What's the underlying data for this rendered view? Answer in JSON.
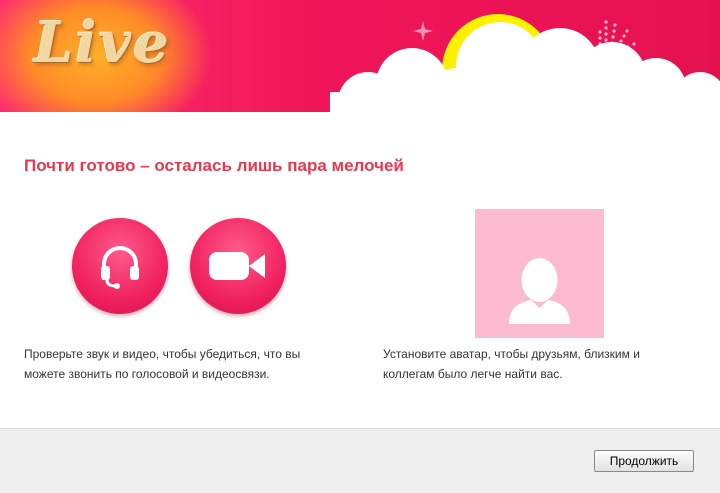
{
  "app": {
    "logo_text": "Live"
  },
  "main": {
    "heading": "Почти готово – осталась лишь пара мелочей",
    "check_devices": {
      "audio_icon": "headset-icon",
      "video_icon": "video-camera-icon",
      "description": "Проверьте звук и видео, чтобы убедиться, что вы можете звонить по голосовой и видеосвязи."
    },
    "avatar": {
      "icon": "user-silhouette-icon",
      "description": "Установите аватар, чтобы друзьям, близким и коллегам было легче найти вас."
    }
  },
  "footer": {
    "continue_label": "Продолжить"
  },
  "colors": {
    "accent": "#e8384f",
    "banner": "#f0155a",
    "sun": "#fff000",
    "avatar_bg": "#fcbbd1"
  }
}
